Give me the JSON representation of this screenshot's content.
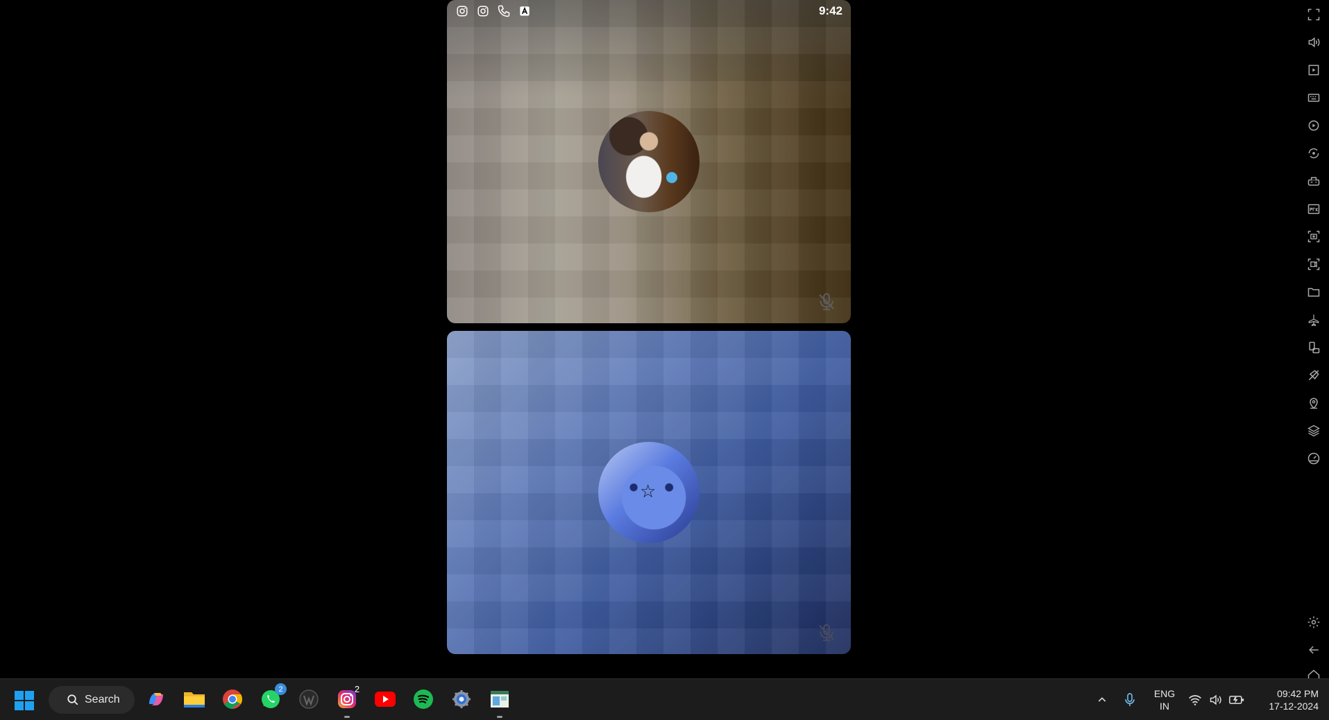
{
  "phone": {
    "status_time": "9:42",
    "status_icons": [
      "instagram-icon",
      "instagram-icon",
      "phone-icon",
      "a-icon"
    ]
  },
  "participants": [
    {
      "avatar": "girl-photo",
      "muted": true
    },
    {
      "avatar": "cat-photo",
      "muted": true
    }
  ],
  "side_toolbar": {
    "top_tools": [
      "fullscreen-icon",
      "volume-icon",
      "media-icon",
      "keyboard-icon",
      "macro-icon",
      "sync-icon",
      "gamepad-icon",
      "apk-icon",
      "screenshot-icon",
      "record-icon",
      "folder-icon",
      "airplane-icon",
      "rotate-icon",
      "eco-icon",
      "location-icon",
      "layers-icon",
      "performance-icon"
    ],
    "bottom_tools": [
      "settings-icon",
      "back-icon",
      "home-icon"
    ]
  },
  "taskbar": {
    "search_label": "Search",
    "apps": [
      {
        "name": "copilot",
        "badge": ""
      },
      {
        "name": "file-explorer",
        "badge": ""
      },
      {
        "name": "chrome",
        "badge": ""
      },
      {
        "name": "whatsapp",
        "badge": "2"
      },
      {
        "name": "wordpress",
        "badge": ""
      },
      {
        "name": "instagram",
        "badge": "2"
      },
      {
        "name": "youtube",
        "badge": ""
      },
      {
        "name": "spotify",
        "badge": ""
      },
      {
        "name": "settings",
        "badge": ""
      },
      {
        "name": "emulator",
        "badge": ""
      }
    ],
    "lang_line1": "ENG",
    "lang_line2": "IN",
    "time": "09:42 PM",
    "date": "17-12-2024"
  },
  "colors": {
    "taskbar_bg": "#1c1c1c",
    "whatsapp_green": "#25d366",
    "youtube_red": "#ff0000",
    "spotify_green": "#1db954",
    "windows_blue": "#0a84ff"
  }
}
